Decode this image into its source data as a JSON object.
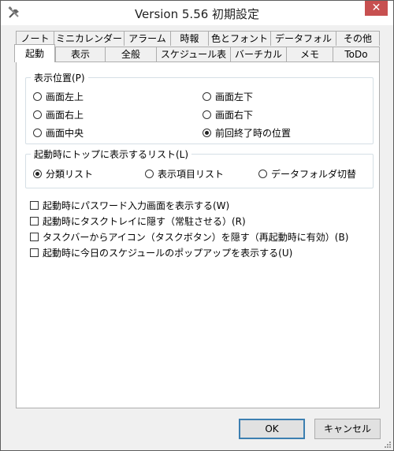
{
  "window": {
    "title": "Version 5.56 初期設定",
    "close_label": "✕"
  },
  "tabs_back": [
    "ノート",
    "ミニカレンダー",
    "アラーム",
    "時報",
    "色とフォント",
    "データフォルダ",
    "その他"
  ],
  "tabs_front": [
    "起動",
    "表示",
    "全般",
    "スケジュール表",
    "バーチカル",
    "メモ",
    "ToDo"
  ],
  "position_group": {
    "legend": "表示位置(P)",
    "options": [
      "画面左上",
      "画面左下",
      "画面右上",
      "画面右下",
      "画面中央",
      "前回終了時の位置"
    ],
    "selected": "前回終了時の位置"
  },
  "list_group": {
    "legend": "起動時にトップに表示するリスト(L)",
    "options": [
      "分類リスト",
      "表示項目リスト",
      "データフォルダ切替"
    ],
    "selected": "分類リスト"
  },
  "checkboxes": [
    {
      "label": "起動時にパスワード入力画面を表示する(W)",
      "checked": false
    },
    {
      "label": "起動時にタスクトレイに隠す（常駐させる）(R)",
      "checked": false
    },
    {
      "label": "タスクバーからアイコン（タスクボタン）を隠す（再起動時に有効）(B)",
      "checked": false
    },
    {
      "label": "起動時に今日のスケジュールのポップアップを表示する(U)",
      "checked": false
    }
  ],
  "buttons": {
    "ok": "OK",
    "cancel": "キャンセル"
  }
}
